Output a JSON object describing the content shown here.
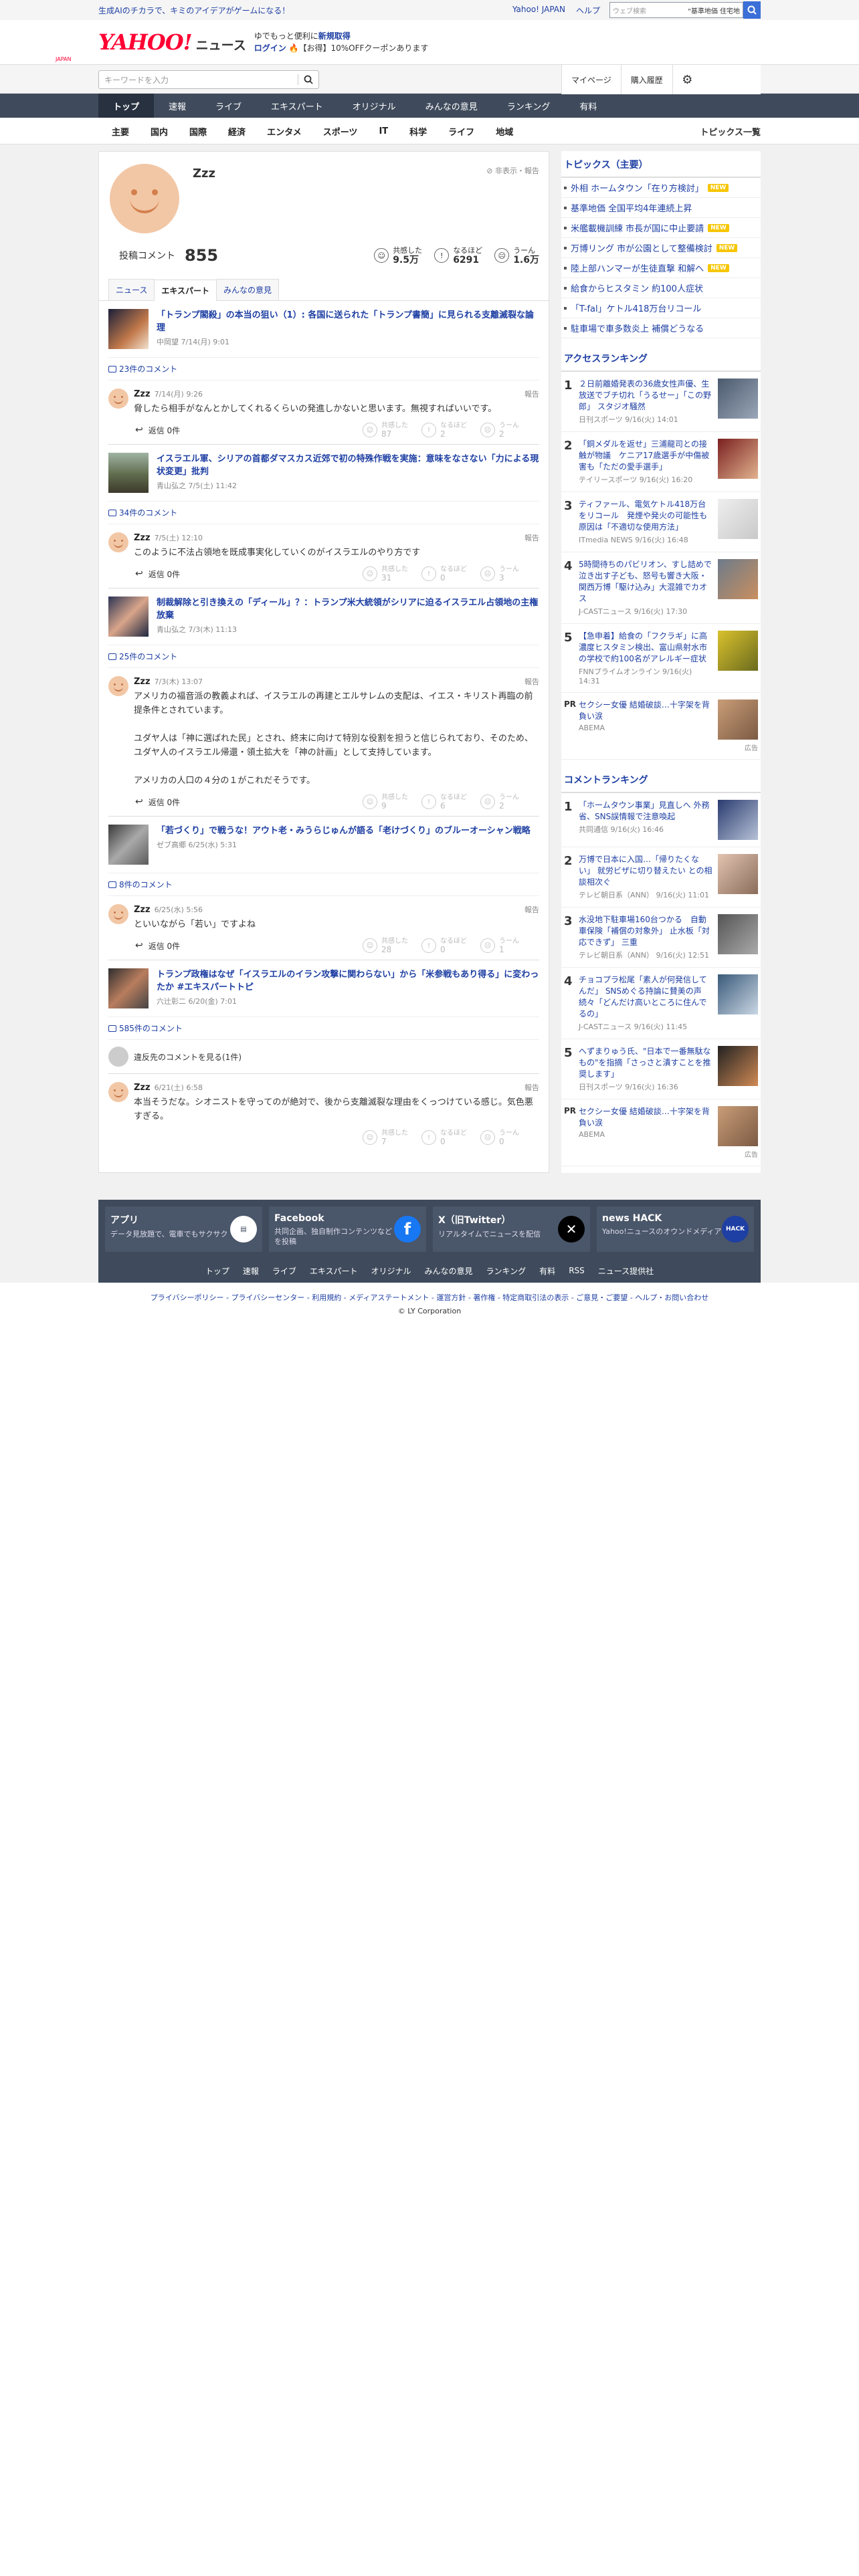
{
  "topbar": {
    "promo": "生成AIのチカラで、キミのアイデアがゲームになる！",
    "links": [
      "Yahoo! JAPAN",
      "ヘルプ"
    ],
    "search_placeholder": "ウェブ検索",
    "search_tag": "\"基準地価 住宅地"
  },
  "header": {
    "logo_main": "YAHOO!",
    "logo_sub": "JAPAN",
    "logo_news": "ニュース",
    "promo_l1_pre": "ゆでもっと便利に",
    "promo_l1_link": "新規取得",
    "promo_l2_link": "ログイン",
    "promo_l2_text": "🔥【お得】10%OFFクーポンあります"
  },
  "searchrow": {
    "placeholder": "キーワードを入力",
    "mypage": "マイページ",
    "history": "購入履歴"
  },
  "nav1": [
    "トップ",
    "速報",
    "ライブ",
    "エキスパート",
    "オリジナル",
    "みんなの意見",
    "ランキング",
    "有料"
  ],
  "nav2": {
    "items": [
      "主要",
      "国内",
      "国際",
      "経済",
      "エンタメ",
      "スポーツ",
      "IT",
      "科学",
      "ライフ",
      "地域"
    ],
    "more": "トピックス一覧"
  },
  "profile": {
    "name": "Zzz",
    "hide_report": "非表示・報告",
    "posts_label": "投稿コメント",
    "posts_count": "855",
    "stat1_label": "共感した",
    "stat1_value": "9.5万",
    "stat2_label": "なるほど",
    "stat2_value": "6291",
    "stat3_label": "うーん",
    "stat3_value": "1.6万"
  },
  "tabs": [
    "ニュース",
    "エキスパート",
    "みんなの意見"
  ],
  "entries": [
    {
      "title": "「トランプ閣殺」の本当の狙い（1）: 各国に送られた「トランプ書簡」に見られる支離滅裂な論理",
      "meta": "中岡望 7/14(月) 9:01",
      "count": "23件のコメント",
      "user": "Zzz",
      "date": "7/14(月) 9:26",
      "report": "報告",
      "text": "脅したら相手がなんとかしてくれるくらいの発進しかないと思います。無視すればいいです。",
      "reply": "返信 0件",
      "r1": "87",
      "r2": "2",
      "r3": "2"
    },
    {
      "title": "イスラエル軍、シリアの首都ダマスカス近郊で初の特殊作戦を実施：意味をなさない「力による現状変更」批判",
      "meta": "青山弘之 7/5(土) 11:42",
      "count": "34件のコメント",
      "user": "Zzz",
      "date": "7/5(土) 12:10",
      "report": "報告",
      "text": "このように不法占領地を既成事実化していくのがイスラエルのやり方です",
      "reply": "返信 0件",
      "r1": "31",
      "r2": "0",
      "r3": "3"
    },
    {
      "title": "制裁解除と引き換えの「ディール」？：トランプ米大統領がシリアに迫るイスラエル占領地の主権放棄",
      "meta": "青山弘之 7/3(木) 11:13",
      "count": "25件のコメント",
      "user": "Zzz",
      "date": "7/3(木) 13:07",
      "report": "報告",
      "text": "アメリカの福音派の教義よれば、イスラエルの再建とエルサレムの支配は、イエス・キリスト再臨の前提条件とされています。\n\nユダヤ人は「神に選ばれた民」とされ、終末に向けて特別な役割を担うと信じられており、そのため、ユダヤ人のイスラエル帰還・領土拡大を「神の計画」として支持しています。\n\nアメリカの人口の４分の１がこれだそうです。",
      "reply": "返信 0件",
      "r1": "9",
      "r2": "6",
      "r3": "2"
    },
    {
      "title": "「若づくり」で戦うな！アウト老・みうらじゅんが語る「老けづくり」のブルーオーシャン戦略",
      "meta": "ゼブ高郷 6/25(水) 5:31",
      "count": "8件のコメント",
      "user": "Zzz",
      "date": "6/25(水) 5:56",
      "report": "報告",
      "text": "といいながら「若い」ですよね",
      "reply": "返信 0件",
      "r1": "28",
      "r2": "0",
      "r3": "1"
    },
    {
      "title": "トランプ政権はなぜ「イスラエルのイラン攻撃に関わらない」から「米参戦もあり得る」に変わったか #エキスパートトピ",
      "meta": "六辻彰二 6/20(金) 7:01",
      "count": "585件のコメント",
      "hidden": "違反先のコメントを見る(1件)",
      "user": "Zzz",
      "date": "6/21(土) 6:58",
      "report": "報告",
      "text": "本当そうだな。シオニストを守ってのが絶対で、後から支離滅裂な理由をくっつけている感じ。気色悪すぎる。",
      "r1": "7",
      "r2": "0",
      "r3": "0"
    }
  ],
  "reaction_labels": [
    "共感した",
    "なるほど",
    "うーん"
  ],
  "right": {
    "topics_head": "トピックス（主要）",
    "topics": [
      {
        "t": "外相 ホームタウン「在り方検討」",
        "new": true
      },
      {
        "t": "基準地価 全国平均4年連続上昇",
        "new": false
      },
      {
        "t": "米艦載機訓練 市長が国に中止要請",
        "new": true
      },
      {
        "t": "万博リング 市が公園として整備検討",
        "new": true
      },
      {
        "t": "陸上部ハンマーが生徒直撃 和解へ",
        "new": true
      },
      {
        "t": "給食からヒスタミン 約100人症状",
        "new": false
      },
      {
        "t": "「T-fal」ケトル418万台リコール",
        "new": false
      },
      {
        "t": "駐車場で車多数炎上 補償どうなる",
        "new": false
      }
    ],
    "new_label": "NEW",
    "access_head": "アクセスランキング",
    "access": [
      {
        "n": "1",
        "t": "２日前離婚発表の36歳女性声優、生放送でブチ切れ「うるせー」「この野郎」 スタジオ騒然",
        "m": "日刊スポーツ 9/16(火) 14:01"
      },
      {
        "n": "2",
        "t": "「銅メダルを返せ」三浦龍司との接触が物議　ケニア17歳選手が中傷被害も「ただの愛手選手」",
        "m": "テイリースポーツ 9/16(火) 16:20"
      },
      {
        "n": "3",
        "t": "ティファール、電気ケトル418万台をリコール　発煙や発火の可能性も　原因は「不適切な使用方法」",
        "m": "ITmedia NEWS 9/16(火) 16:48"
      },
      {
        "n": "4",
        "t": "5時間待ちのパビリオン、すし詰めで泣き出す子ども、怒号も響き大阪・関西万博「駆け込み」大混雑でカオス",
        "m": "J-CASTニュース 9/16(火) 17:30"
      },
      {
        "n": "5",
        "t": "【急申着】給食の「フクラギ」に高濃度ヒスタミン検出、富山県射水市の学校で約100名がアレルギー症状",
        "m": "FNNプライムオンライン 9/16(火) 14:31"
      }
    ],
    "pr1_t": "セクシー女優 結婚破談…十字架を背負い涙",
    "pr1_m": "ABEMA",
    "ad_label": "広告",
    "comment_head": "コメントランキング",
    "comment": [
      {
        "n": "1",
        "t": "「ホームタウン事業」見直しへ 外務省、SNS誤情報で注意喚起",
        "m": "共同通信 9/16(火) 16:46"
      },
      {
        "n": "2",
        "t": "万博で日本に入国…「帰りたくない」 就労ビザに切り替えたい との相談相次ぐ",
        "m": "テレビ朝日系（ANN） 9/16(火) 11:01"
      },
      {
        "n": "3",
        "t": "水没地下駐車場160台つかる　自動車保険「補償の対象外」 止水板「対応できず」 三重",
        "m": "テレビ朝日系（ANN） 9/16(火) 12:51"
      },
      {
        "n": "4",
        "t": "チョコプラ松尾「素人が何発信してんだ」 SNSめぐる持論に賛美の声続々「どんだけ高いところに住んでるの」",
        "m": "J-CASTニュース 9/16(火) 11:45"
      },
      {
        "n": "5",
        "t": "へずまりゅう氏、\"日本で一番無駄なもの\"を指摘「さっさと潰すことを推奨します」",
        "m": "日刊スポーツ 9/16(火) 16:36"
      }
    ],
    "pr2_t": "セクシー女優 結婚破談…十字架を背負い涙",
    "pr2_m": "ABEMA"
  },
  "footer": {
    "cards": [
      {
        "t": "アプリ",
        "d": "データ見放題で、電車でもサクサク"
      },
      {
        "t": "Facebook",
        "d": "共同企画、独自制作コンテンツなどを投稿"
      },
      {
        "t": "X（旧Twitter）",
        "d": "リアルタイムでニュースを配信"
      },
      {
        "t": "news HACK",
        "d": "Yahoo!ニュースのオウンドメディア"
      }
    ],
    "nav": [
      "トップ",
      "速報",
      "ライブ",
      "エキスパート",
      "オリジナル",
      "みんなの意見",
      "ランキング",
      "有料",
      "RSS",
      "ニュース提供社"
    ],
    "links": "プライバシーポリシー - プライバシーセンター - 利用規約 - メディアステートメント - 運営方針 - 著作権 - 特定商取引法の表示 - ご意見・ご要望 - ヘルプ・お問い合わせ",
    "copyright": "© LY Corporation"
  }
}
